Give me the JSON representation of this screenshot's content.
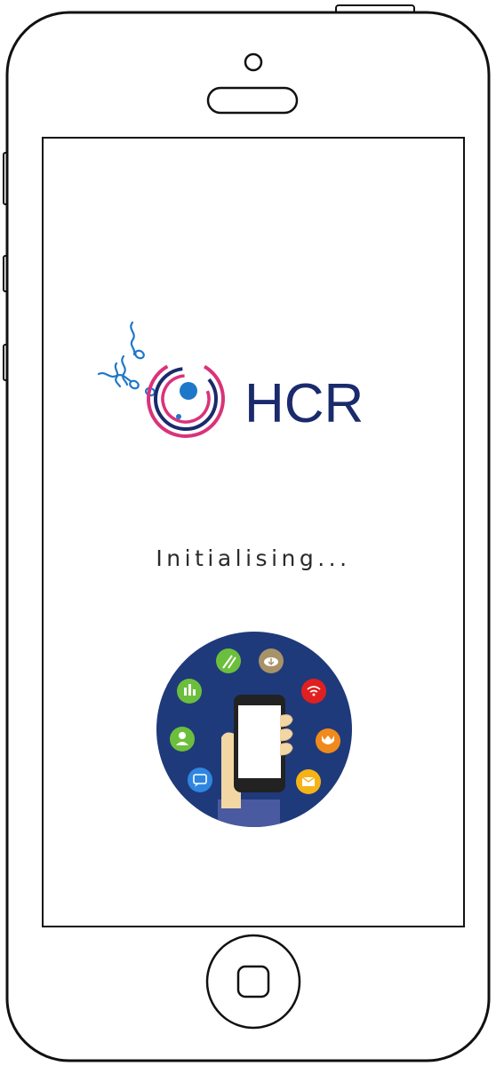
{
  "app": {
    "brand_name": "HCR",
    "status_text": "Initialising..."
  },
  "illustration": {
    "icons": [
      "sperm-icon",
      "cloud-download-icon",
      "wifi-icon",
      "bar-chart-icon",
      "user-icon",
      "chat-icon",
      "email-icon",
      "crown-icon"
    ]
  },
  "colors": {
    "brand_navy": "#1a2a6c",
    "brand_pink": "#d9337a",
    "brand_blue": "#1f77c9",
    "illustration_bg": "#1f3a7a"
  }
}
